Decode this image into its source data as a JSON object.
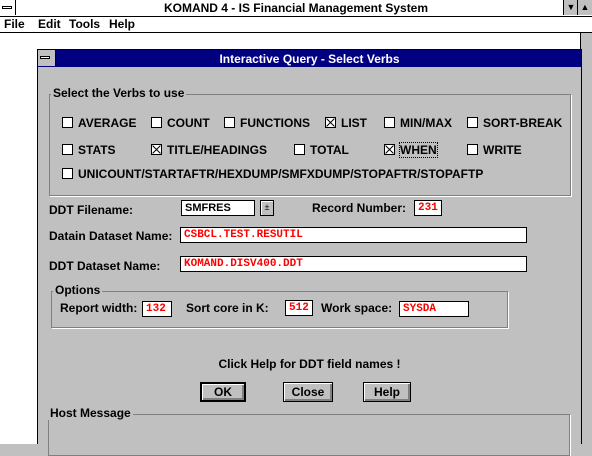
{
  "app": {
    "title": "KOMAND 4 - IS Financial Management System",
    "system_menu_icon": "system-menu-icon",
    "minimize_glyph": "▼",
    "maximize_glyph": "▲"
  },
  "menubar": {
    "items": [
      "File",
      "Edit",
      "Tools",
      "Help"
    ]
  },
  "dialog": {
    "title": "Interactive Query - Select Verbs",
    "verbs_group_label": "Select the Verbs to use",
    "verbs": [
      {
        "label": "AVERAGE",
        "checked": false
      },
      {
        "label": "COUNT",
        "checked": false
      },
      {
        "label": "FUNCTIONS",
        "checked": false
      },
      {
        "label": "LIST",
        "checked": true
      },
      {
        "label": "MIN/MAX",
        "checked": false
      },
      {
        "label": "SORT-BREAK",
        "checked": false
      },
      {
        "label": "STATS",
        "checked": false
      },
      {
        "label": "TITLE/HEADINGS",
        "checked": true
      },
      {
        "label": "TOTAL",
        "checked": false
      },
      {
        "label": "WHEN",
        "checked": true
      },
      {
        "label": "WRITE",
        "checked": false
      },
      {
        "label": "UNICOUNT/STARTAFTR/HEXDUMP/SMFXDUMP/STOPAFTR/STOPAFTP",
        "checked": false
      }
    ],
    "ddt_filename_label": "DDT Filename:",
    "ddt_filename_value": "SMFRES",
    "spin_glyph": "±",
    "record_number_label": "Record Number:",
    "record_number_value": "231",
    "datain_label": "Datain Dataset Name:",
    "datain_value": "CSBCL.TEST.RESUTIL",
    "ddt_dataset_label": "DDT Dataset Name:",
    "ddt_dataset_value": "KOMAND.DISV400.DDT",
    "options": {
      "group_label": "Options",
      "report_width_label": "Report width:",
      "report_width_value": "132",
      "sort_core_label": "Sort core in K:",
      "sort_core_value": "512",
      "work_space_label": "Work space:",
      "work_space_value": "SYSDA"
    },
    "help_hint": "Click Help for DDT field names !",
    "buttons": {
      "ok": "OK",
      "close": "Close",
      "help": "Help"
    },
    "host_message_label": "Host Message",
    "host_message_value": ""
  },
  "colors": {
    "dialog_title_bg": "#000080",
    "face": "#c0c0c0",
    "field_text": "#ff0000"
  }
}
